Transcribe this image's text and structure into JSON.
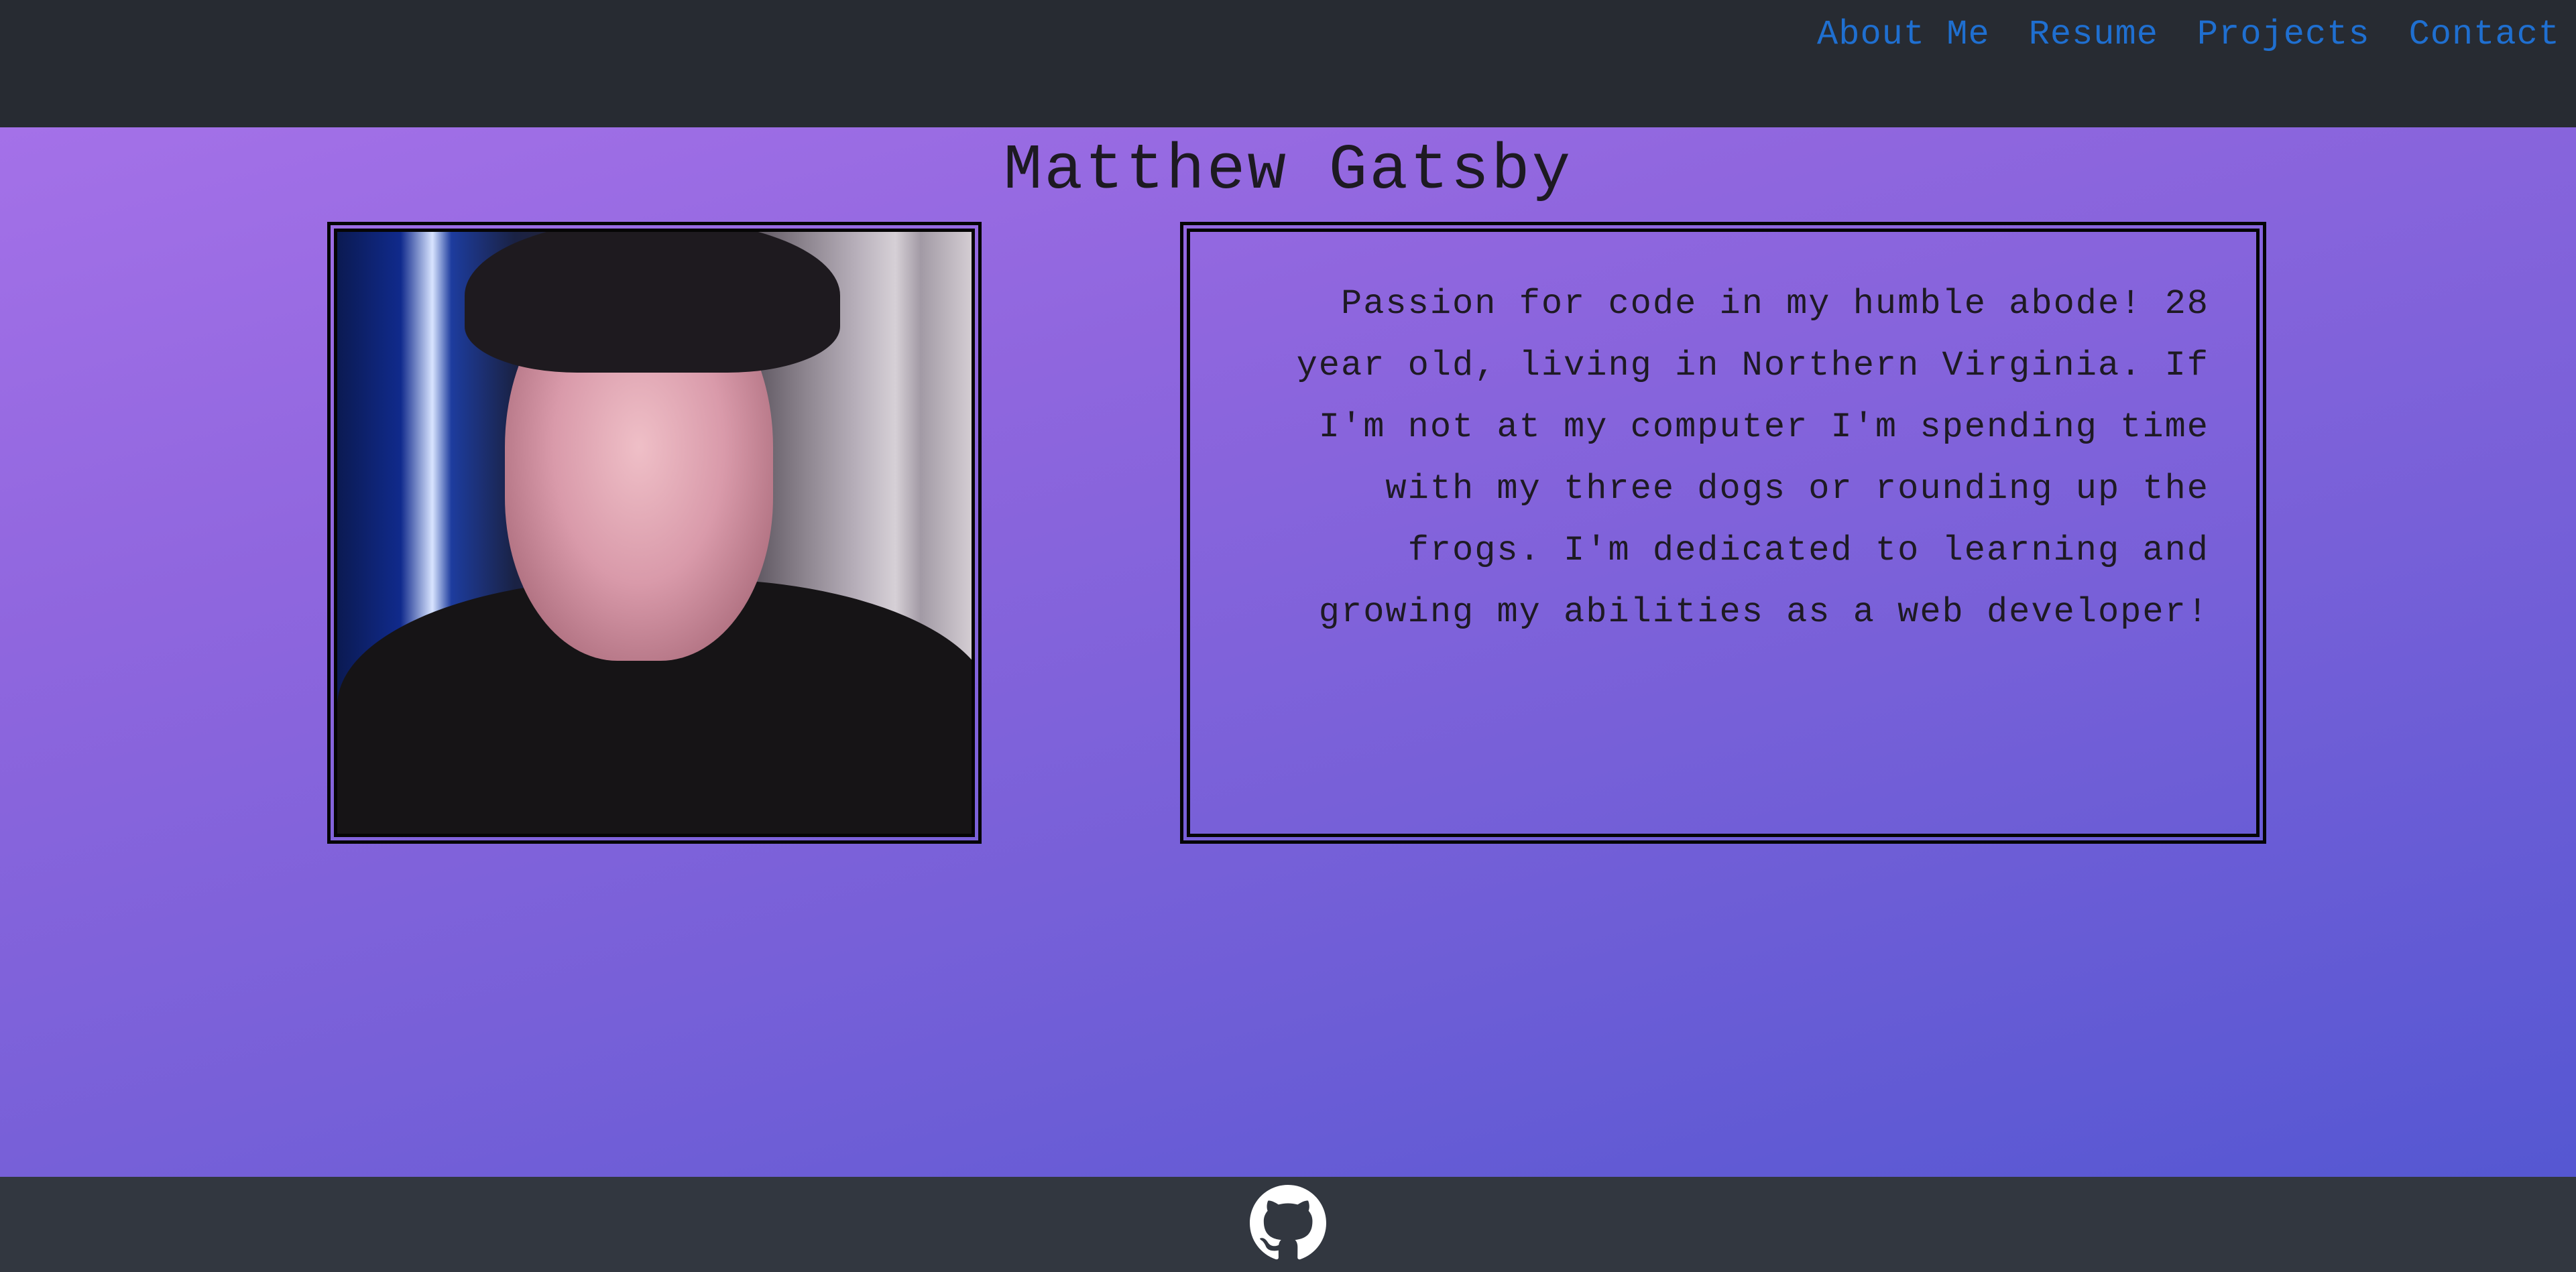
{
  "header": {
    "nav": [
      "About Me",
      "Resume",
      "Projects",
      "Contact"
    ]
  },
  "profile": {
    "name": "Matthew Gatsby",
    "photo_alt": "portrait photo",
    "bio": "Passion for code in my humble abode! 28 year old, living in Northern Virginia. If I'm not at my computer I'm spending time with my three dogs or rounding up the frogs. I'm dedicated to learning and growing my abilities as a web developer!"
  },
  "footer": {
    "icon": "github-icon"
  },
  "colors": {
    "header_bg": "#272b32",
    "nav_link": "#1f6fd0",
    "gradient_start": "#a471e8",
    "gradient_end": "#5557d2",
    "footer_bg": "#323740"
  }
}
